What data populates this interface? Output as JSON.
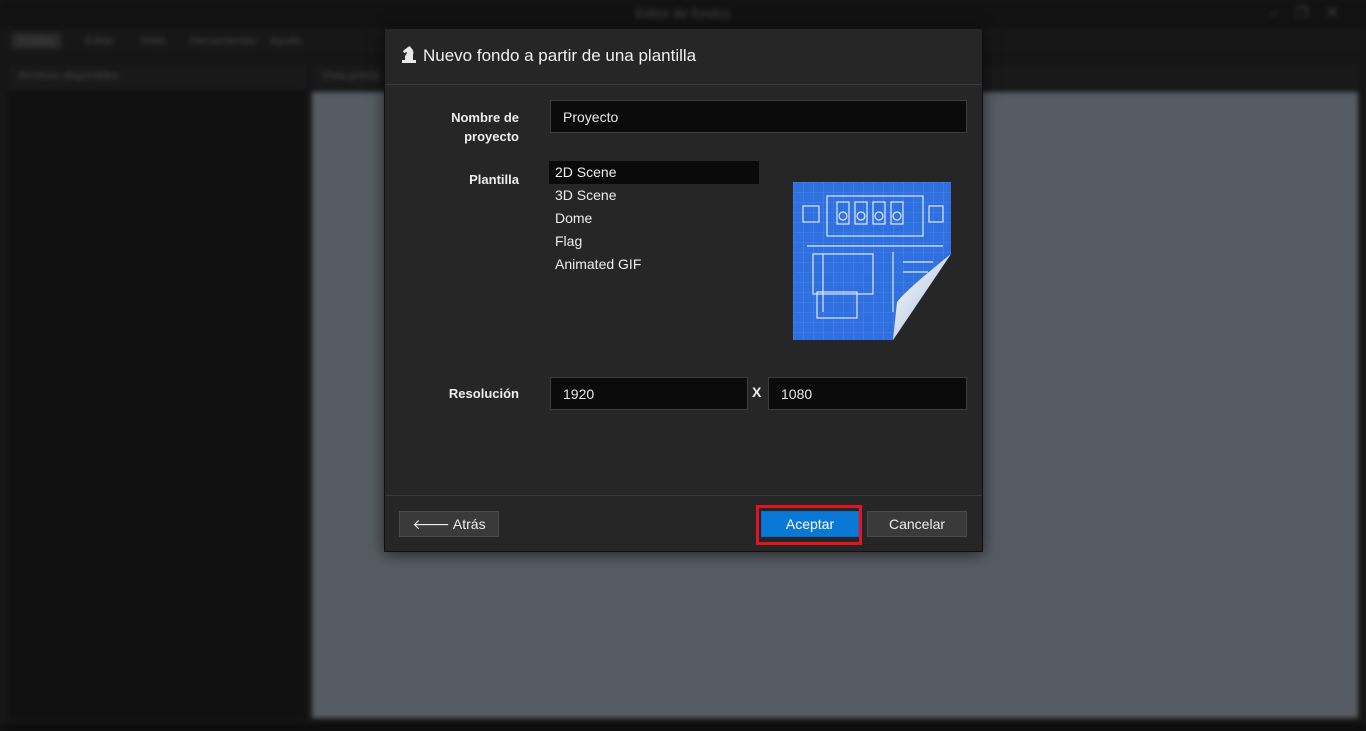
{
  "background": {
    "window_title": "Editor de fondos",
    "window_controls": [
      "–",
      "❐",
      "✕"
    ],
    "menu": [
      "Archivo",
      "Editar",
      "Vista",
      "Herramientas",
      "Ayuda"
    ],
    "sidebar_title": "Archivos disponibles",
    "main_title": "Vista previa"
  },
  "dialog": {
    "title": "Nuevo fondo a partir de una plantilla",
    "project_name_label_line1": "Nombre de",
    "project_name_label_line2": "proyecto",
    "project_name_value": "Proyecto",
    "template_label": "Plantilla",
    "templates": [
      "2D Scene",
      "3D Scene",
      "Dome",
      "Flag",
      "Animated GIF"
    ],
    "selected_template": "2D Scene",
    "resolution_label": "Resolución",
    "resolution_width": "1920",
    "resolution_separator": "X",
    "resolution_height": "1080",
    "back_label": "Atrás",
    "accept_label": "Aceptar",
    "cancel_label": "Cancelar"
  },
  "colors": {
    "accent": "#0a78d7",
    "highlight": "#e3141f",
    "dialog_bg": "#262626",
    "blueprint": "#2f6fe0"
  }
}
